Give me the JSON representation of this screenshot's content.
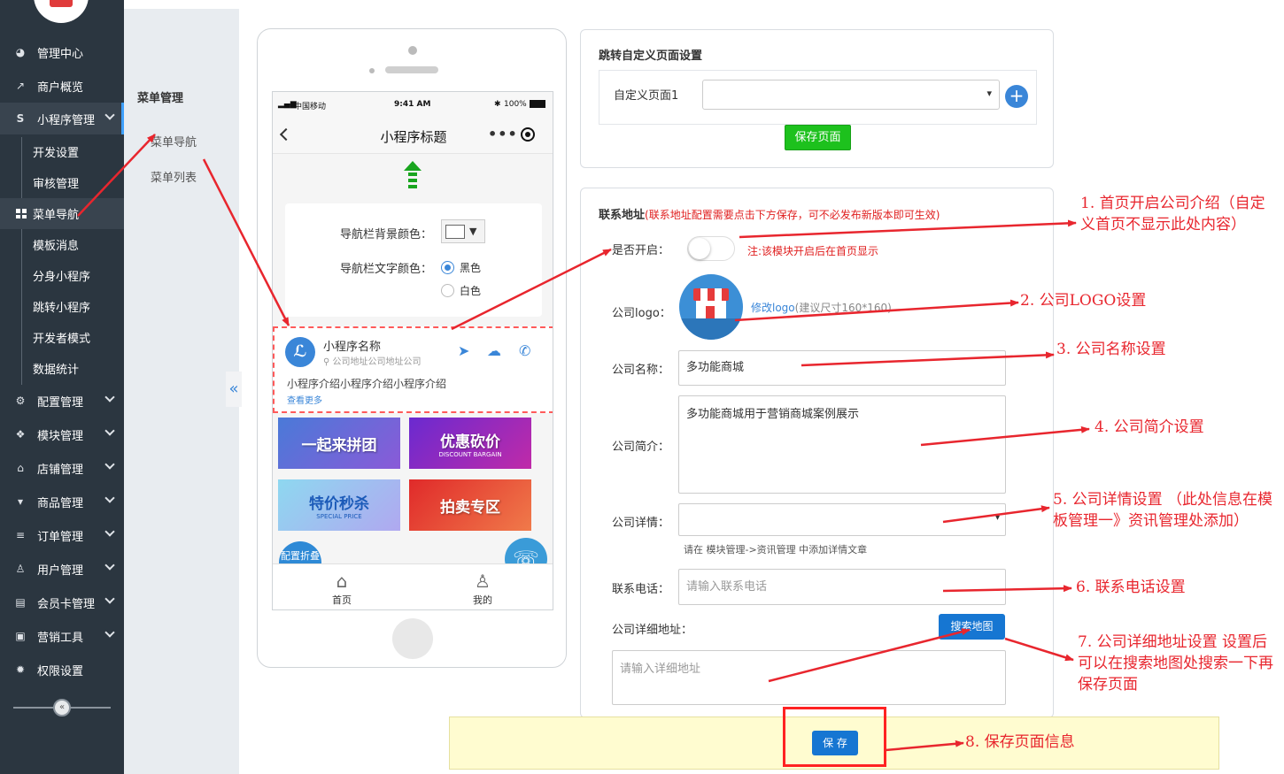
{
  "sidebar": {
    "items": [
      {
        "label": "管理中心",
        "icon": "dashboard-icon"
      },
      {
        "label": "商户概览",
        "icon": "line-chart-icon"
      },
      {
        "label": "小程序管理",
        "icon": "miniprogram-icon"
      },
      {
        "label": "配置管理",
        "icon": "cogs-icon"
      },
      {
        "label": "模块管理",
        "icon": "cubes-icon"
      },
      {
        "label": "店铺管理",
        "icon": "bank-icon"
      },
      {
        "label": "商品管理",
        "icon": "cart-icon"
      },
      {
        "label": "订单管理",
        "icon": "list-icon"
      },
      {
        "label": "用户管理",
        "icon": "user-icon"
      },
      {
        "label": "会员卡管理",
        "icon": "card-icon"
      },
      {
        "label": "营销工具",
        "icon": "briefcase-icon"
      },
      {
        "label": "权限设置",
        "icon": "gear-icon"
      }
    ],
    "subitems": [
      "开发设置",
      "审核管理",
      "菜单导航",
      "模板消息",
      "分身小程序",
      "跳转小程序",
      "开发者模式",
      "数据统计"
    ]
  },
  "submenu": {
    "title": "菜单管理",
    "items": [
      "菜单导航",
      "菜单列表"
    ]
  },
  "phone": {
    "carrier": "中国移动",
    "time": "9:41 AM",
    "battery": "100%",
    "title": "小程序标题",
    "nav_bg_label": "导航栏背景颜色：",
    "nav_text_label": "导航栏文字颜色：",
    "opt_black": "黑色",
    "opt_white": "白色",
    "company_name": "小程序名称",
    "company_addr": "公司地址公司地址公司",
    "company_intro": "小程序介绍小程序介绍小程序介绍",
    "see_more": "查看更多",
    "banners": [
      {
        "text": "一起来拼团",
        "sub": ""
      },
      {
        "text": "优惠砍价",
        "sub": "DISCOUNT BARGAIN"
      },
      {
        "text": "特价秒杀",
        "sub": "SPECIAL PRICE"
      },
      {
        "text": "拍卖专区",
        "sub": ""
      }
    ],
    "fab_left": "配置折叠菜单",
    "tabs": [
      "首页",
      "我的"
    ]
  },
  "jump_card": {
    "title": "跳转自定义页面设置",
    "label": "自定义页面1",
    "save": "保存页面"
  },
  "contact": {
    "title": "联系地址",
    "title_note": "(联系地址配置需要点击下方保存，可不必发布新版本即可生效)",
    "enable_label": "是否开启：",
    "enable_note": "注:该模块开启后在首页显示",
    "logo_label": "公司logo：",
    "modify_logo": "修改logo",
    "logo_hint": "(建议尺寸160*160)",
    "name_label": "公司名称：",
    "name_value": "多功能商城",
    "intro_label": "公司简介：",
    "intro_value": "多功能商城用于营销商城案例展示",
    "detail_label": "公司详情：",
    "detail_hint": "请在 模块管理->资讯管理 中添加详情文章",
    "phone_label": "联系电话：",
    "phone_placeholder": "请输入联系电话",
    "addr_label": "公司详细地址：",
    "map_button": "搜索地图",
    "addr_placeholder": "请输入详细地址",
    "save": "保 存"
  },
  "annotations": [
    "1.  首页开启公司介绍（自定义首页不显示此处内容）",
    "2.  公司LOGO设置",
    "3.  公司名称设置",
    "4.  公司简介设置",
    "5.  公司详情设置 （此处信息在模板管理一》资讯管理处添加）",
    "6.  联系电话设置",
    "7.  公司详细地址设置 设置后可以在搜索地图处搜索一下再保存页面",
    "8.  保存页面信息"
  ],
  "colors": {
    "sidebar_bg": "#2b3640",
    "accent": "#3a86d8",
    "annotation_red": "#e8262e",
    "save_green": "#1dc11d"
  }
}
